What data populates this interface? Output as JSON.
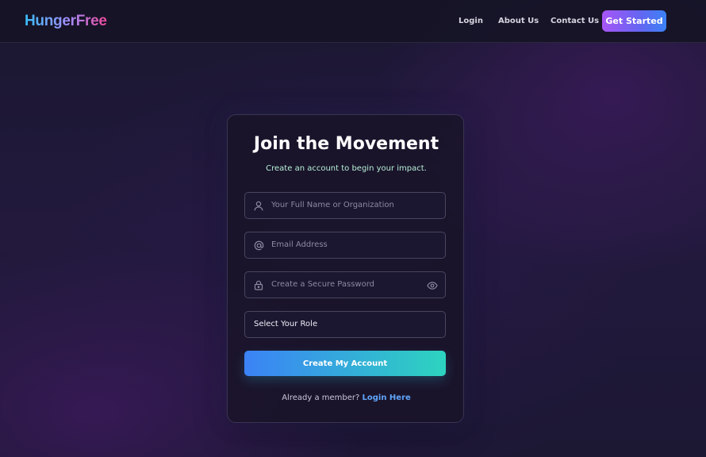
{
  "nav": {
    "logo": "HungerFree",
    "links": [
      "Login",
      "About Us",
      "Contact Us"
    ],
    "cta": "Get Started"
  },
  "card": {
    "title": "Join the Movement",
    "subtitle": "Create an account to begin your impact.",
    "fields": {
      "name": {
        "placeholder": "Your Full Name or Organization",
        "icon": "user-icon"
      },
      "email": {
        "placeholder": "Email Address",
        "icon": "at-icon"
      },
      "password": {
        "placeholder": "Create a Secure Password",
        "icon": "lock-icon",
        "toggle_icon": "eye-icon"
      },
      "role": {
        "value": "Select Your Role"
      }
    },
    "submit": "Create My Account",
    "footer_text": "Already a member?",
    "footer_link": "Login Here"
  },
  "colors": {
    "accent_purple": "#a855f7",
    "accent_blue": "#3b82f6",
    "accent_teal": "#2dd4bf",
    "link_blue": "#60a5fa"
  }
}
